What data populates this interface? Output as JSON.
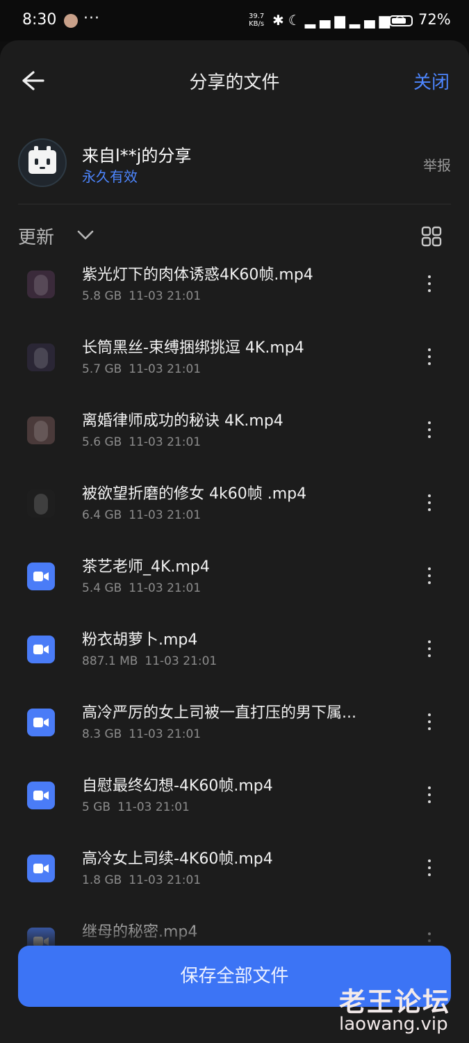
{
  "status_bar": {
    "time": "8:30",
    "more": "···",
    "speed_value": "39.7",
    "speed_unit": "KB/s",
    "battery": "72%"
  },
  "header": {
    "title": "分享的文件",
    "close_label": "关闭"
  },
  "share": {
    "title": "来自l**j的分享",
    "validity": "永久有效",
    "report_label": "举报"
  },
  "toolbar": {
    "sort_label": "更新"
  },
  "files": [
    {
      "name": "紫光灯下的肉体诱惑4K60帧.mp4",
      "size": "5.8 GB",
      "date": "11-03 21:01",
      "thumb": "photo",
      "color": "#3a2a3a"
    },
    {
      "name": "长筒黑丝-束缚捆绑挑逗 4K.mp4",
      "size": "5.7 GB",
      "date": "11-03 21:01",
      "thumb": "photo",
      "color": "#2a2635"
    },
    {
      "name": "离婚律师成功的秘诀 4K.mp4",
      "size": "5.6 GB",
      "date": "11-03 21:01",
      "thumb": "photo",
      "color": "#4a3a3a"
    },
    {
      "name": "被欲望折磨的修女   4k60帧 .mp4",
      "size": "6.4 GB",
      "date": "11-03 21:01",
      "thumb": "photo",
      "color": "#1e1e1e"
    },
    {
      "name": "茶艺老师_4K.mp4",
      "size": "5.4 GB",
      "date": "11-03 21:01",
      "thumb": "video",
      "color": "#4a7cf7"
    },
    {
      "name": "粉衣胡萝卜.mp4",
      "size": "887.1 MB",
      "date": "11-03 21:01",
      "thumb": "video",
      "color": "#4a7cf7"
    },
    {
      "name": "高冷严厉的女上司被一直打压的男下属...",
      "size": "8.3 GB",
      "date": "11-03 21:01",
      "thumb": "video",
      "color": "#4a7cf7"
    },
    {
      "name": "自慰最终幻想-4K60帧.mp4",
      "size": "5 GB",
      "date": "11-03 21:01",
      "thumb": "video",
      "color": "#4a7cf7"
    },
    {
      "name": "高冷女上司续-4K60帧.mp4",
      "size": "1.8 GB",
      "date": "11-03 21:01",
      "thumb": "video",
      "color": "#4a7cf7"
    },
    {
      "name": "继母的秘密.mp4",
      "size": "",
      "date": "",
      "thumb": "video",
      "color": "#4a7cf7"
    }
  ],
  "footer": {
    "save_all_label": "保存全部文件"
  },
  "watermark": {
    "name": "老王论坛",
    "url": "laowang.vip"
  }
}
